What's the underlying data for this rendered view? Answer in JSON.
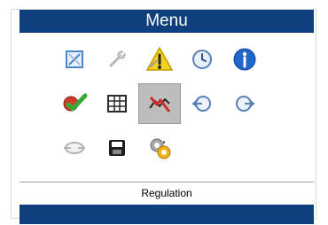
{
  "window": {
    "title": "Menu"
  },
  "status": {
    "label": "Regulation"
  },
  "grid": {
    "rows": [
      [
        "display-icon",
        "wrench-icon",
        "warning-tools-icon",
        "clock-icon",
        "info-icon"
      ],
      [
        "checkmark-diagnostics-icon",
        "table-icon",
        "regulation-chart-icon",
        "circle-arrow-left-icon",
        "circle-arrow-right-icon"
      ],
      [
        "connection-icon",
        "save-disk-icon",
        "settings-gears-icon"
      ]
    ],
    "selected": "regulation-chart-icon"
  },
  "colors": {
    "accent": "#0f3f7d",
    "selected_bg": "#bdbdbd"
  }
}
